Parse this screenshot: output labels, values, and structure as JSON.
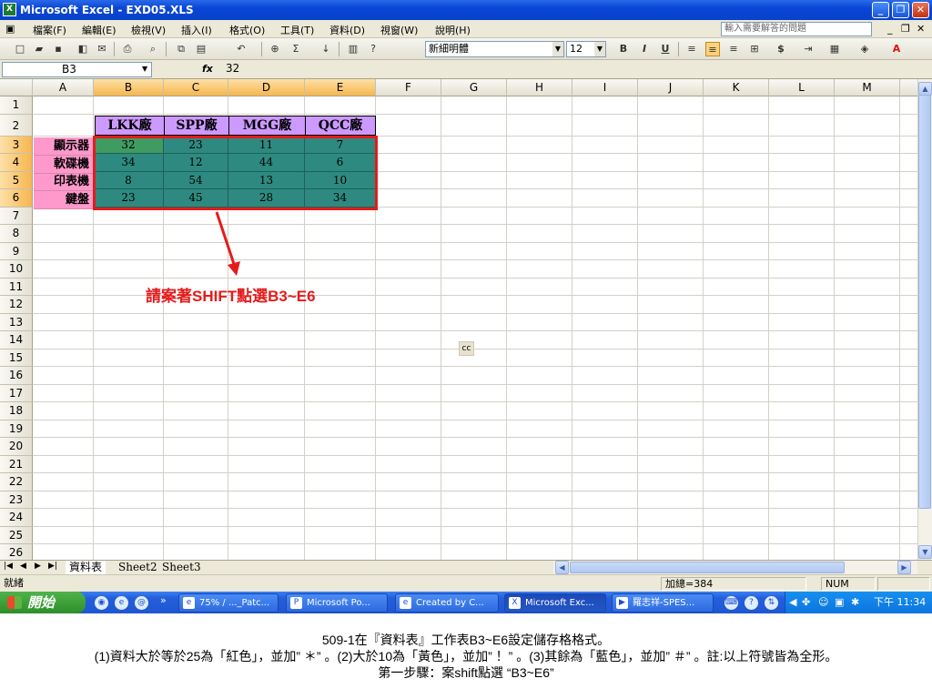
{
  "window": {
    "title": "Microsoft Excel - EXD05.XLS",
    "icon": "excel-icon"
  },
  "menu": {
    "items": [
      "檔案(F)",
      "編輯(E)",
      "檢視(V)",
      "插入(I)",
      "格式(O)",
      "工具(T)",
      "資料(D)",
      "視窗(W)",
      "說明(H)"
    ],
    "help_placeholder": "輸入需要解答的問題"
  },
  "toolbar": {
    "font_name": "新細明體",
    "font_size": "12",
    "bold": "B",
    "italic": "I",
    "underline": "U",
    "currency": "$",
    "sum": "Σ"
  },
  "formula_bar": {
    "name_box": "B3",
    "fx": "fx",
    "value": "32"
  },
  "columns": [
    "A",
    "B",
    "C",
    "D",
    "E",
    "F",
    "G",
    "H",
    "I",
    "J",
    "K",
    "L",
    "M"
  ],
  "rows": [
    "1",
    "2",
    "3",
    "4",
    "5",
    "6",
    "7",
    "8",
    "9",
    "10",
    "11",
    "12",
    "13",
    "14",
    "15",
    "16",
    "17",
    "18",
    "19",
    "20",
    "21",
    "22",
    "23",
    "24",
    "25",
    "26"
  ],
  "sheet": {
    "headers": [
      "LKK廠",
      "SPP廠",
      "MGG廠",
      "QCC廠"
    ],
    "row_labels": [
      "顯示器",
      "軟碟機",
      "印表機",
      "鍵盤"
    ],
    "values": [
      [
        "32",
        "23",
        "11",
        "7"
      ],
      [
        "34",
        "12",
        "44",
        "6"
      ],
      [
        "8",
        "54",
        "13",
        "10"
      ],
      [
        "23",
        "45",
        "28",
        "34"
      ]
    ],
    "selection_color": "#e41b1b",
    "cell_fill": "#2e8a80",
    "header_fill": "#cc99ff",
    "label_fill": "#ff99cc"
  },
  "annotation": {
    "text": "請案著SHIFT點選B3~E6",
    "marker": "cc"
  },
  "tabs": [
    "資料表",
    "Sheet2",
    "Sheet3"
  ],
  "status": {
    "ready": "就緒",
    "sum": "加總=384",
    "num": "NUM"
  },
  "taskbar": {
    "start": "開始",
    "buttons": [
      "75% / ..._Patc...",
      "Microsoft Po...",
      "Created by C...",
      "Microsoft Exc...",
      "羅志祥-SPES..."
    ],
    "clock": "下午 11:34"
  },
  "caption": {
    "line1": "509-1在『資料表』工作表B3~E6設定儲存格格式。",
    "line2": "(1)資料大於等於25為「紅色」，並加” ＊” 。(2)大於10為「黃色」，並加” ！” 。(3)其餘為「藍色」，並加” ＃” 。註:以上符號皆為全形。",
    "line3": "第一步驟：案shift點選 “B3~E6”"
  }
}
